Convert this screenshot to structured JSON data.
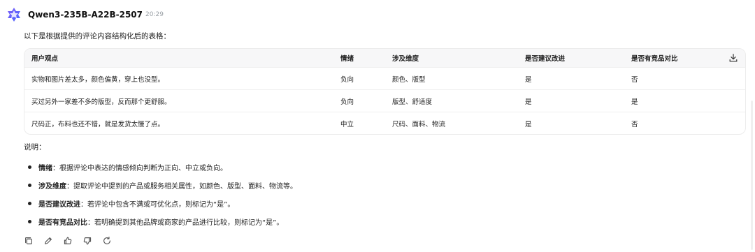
{
  "message": {
    "model_name": "Qwen3-235B-A22B-2507",
    "time": "20:29",
    "intro": "以下是根据提供的评论内容结构化后的表格："
  },
  "table": {
    "headers": [
      "用户观点",
      "情绪",
      "涉及维度",
      "是否建议改进",
      "是否有竞品对比"
    ],
    "rows": [
      [
        "实物和图片差太多，颜色偏黄，穿上也没型。",
        "负向",
        "颜色、版型",
        "是",
        "否"
      ],
      [
        "买过另外一家差不多的版型，反而那个更舒服。",
        "负向",
        "版型、舒适度",
        "是",
        "是"
      ],
      [
        "尺码正，布料也还不错，就是发货太慢了点。",
        "中立",
        "尺码、面料、物流",
        "是",
        "否"
      ]
    ]
  },
  "notes": {
    "title": "说明：",
    "items": [
      {
        "term": "情绪",
        "text": "：根据评论中表达的情感倾向判断为正向、中立或负向。"
      },
      {
        "term": "涉及维度",
        "text": "：提取评论中提到的产品或服务相关属性，如颜色、版型、面料、物流等。"
      },
      {
        "term": "是否建议改进",
        "text": "：若评论中包含不满或可优化点，则标记为“是”。"
      },
      {
        "term": "是否有竞品对比",
        "text": "：若明确提到其他品牌或商家的产品进行比较，则标记为“是”。"
      }
    ]
  },
  "icons": {
    "avatar": "qwen-logo-icon",
    "download": "download-icon",
    "copy": "copy-icon",
    "edit": "edit-icon",
    "like": "thumb-up-icon",
    "dislike": "thumb-down-icon",
    "regenerate": "refresh-icon"
  },
  "colors": {
    "brand": "#6f5bd6",
    "table_header_bg": "#f7f7f8",
    "border": "#ececec"
  }
}
